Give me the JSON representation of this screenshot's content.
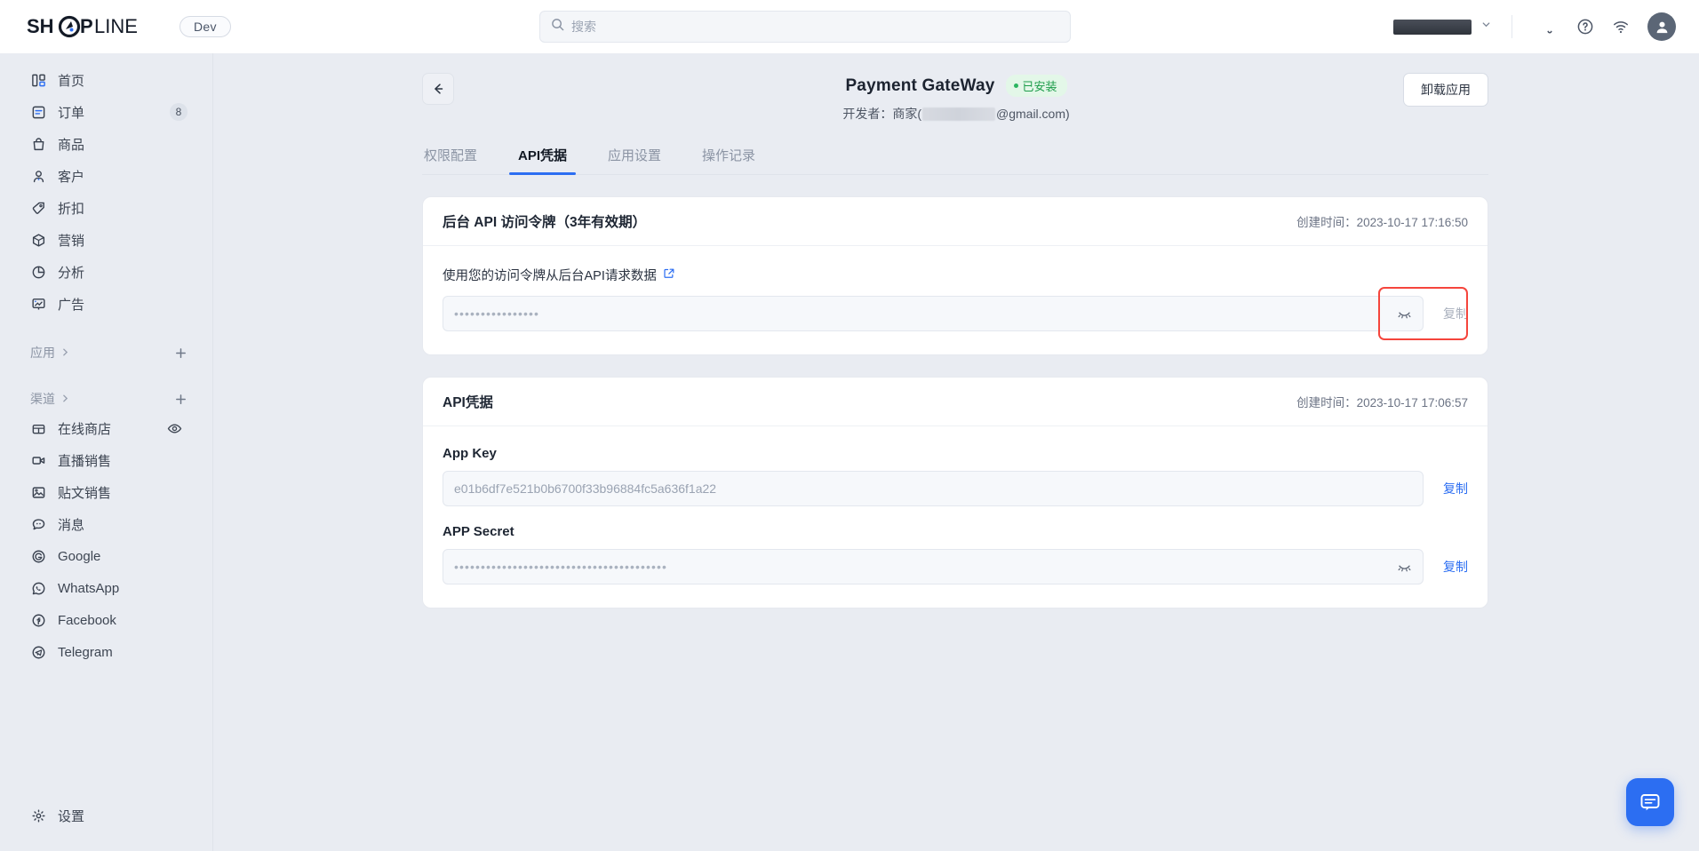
{
  "topbar": {
    "logo_text": "SHOPLINE",
    "dev_badge": "Dev",
    "search_placeholder": "搜索",
    "icons": {
      "search": "search-icon",
      "notification": "bell-icon",
      "help": "question-circle-icon",
      "wifi": "wifi-icon",
      "avatar": "user-avatar-icon",
      "chevron": "chevron-down-icon"
    }
  },
  "sidebar": {
    "items": [
      {
        "label": "首页",
        "icon": "dashboard-icon",
        "badge": ""
      },
      {
        "label": "订单",
        "icon": "order-icon",
        "badge": "8"
      },
      {
        "label": "商品",
        "icon": "bag-icon",
        "badge": ""
      },
      {
        "label": "客户",
        "icon": "user-icon",
        "badge": ""
      },
      {
        "label": "折扣",
        "icon": "tag-icon",
        "badge": ""
      },
      {
        "label": "营销",
        "icon": "cube-icon",
        "badge": ""
      },
      {
        "label": "分析",
        "icon": "pie-chart-icon",
        "badge": ""
      },
      {
        "label": "广告",
        "icon": "ads-icon",
        "badge": ""
      }
    ],
    "sections": [
      {
        "label": "应用",
        "icon": "chevron-right-icon",
        "action": "add-icon"
      },
      {
        "label": "渠道",
        "icon": "chevron-right-icon",
        "action": "add-icon"
      }
    ],
    "channels": [
      {
        "label": "在线商店",
        "icon": "store-icon",
        "trailing": "eye-icon"
      },
      {
        "label": "直播销售",
        "icon": "video-icon",
        "trailing": ""
      },
      {
        "label": "贴文销售",
        "icon": "image-icon",
        "trailing": ""
      },
      {
        "label": "消息",
        "icon": "message-icon",
        "trailing": ""
      },
      {
        "label": "Google",
        "icon": "google-icon",
        "trailing": ""
      },
      {
        "label": "WhatsApp",
        "icon": "whatsapp-icon",
        "trailing": ""
      },
      {
        "label": "Facebook",
        "icon": "facebook-icon",
        "trailing": ""
      },
      {
        "label": "Telegram",
        "icon": "telegram-icon",
        "trailing": ""
      }
    ],
    "settings": {
      "label": "设置",
      "icon": "gear-icon"
    }
  },
  "page": {
    "back_icon": "arrow-left-icon",
    "app_title": "Payment GateWay",
    "status_badge": "已安装",
    "developer_prefix": "开发者：商家(",
    "developer_suffix": "@gmail.com)",
    "uninstall_label": "卸载应用"
  },
  "tabs": [
    {
      "label": "权限配置",
      "active": false
    },
    {
      "label": "API凭据",
      "active": true
    },
    {
      "label": "应用设置",
      "active": false
    },
    {
      "label": "操作记录",
      "active": false
    }
  ],
  "token_card": {
    "title": "后台 API 访问令牌（3年有效期）",
    "created_label": "创建时间：",
    "created_time": "2023-10-17 17:16:50",
    "desc": "使用您的访问令牌从后台API请求数据",
    "external_icon": "external-link-icon",
    "token_masked": "••••••••••••••••",
    "eye_icon": "eye-closed-icon",
    "copy_label": "复制"
  },
  "credential_card": {
    "title": "API凭据",
    "created_label": "创建时间：",
    "created_time": "2023-10-17 17:06:57",
    "app_key_label": "App Key",
    "app_key_value": "e01b6df7e521b0b6700f33b96884fc5a636f1a22",
    "app_key_copy": "复制",
    "app_secret_label": "APP Secret",
    "app_secret_masked": "••••••••••••••••••••••••••••••••••••••••",
    "app_secret_eye": "eye-closed-icon",
    "app_secret_copy": "复制"
  },
  "chat": {
    "icon": "chat-bubble-icon"
  },
  "colors": {
    "accent": "#2c6ef2",
    "success": "#2bb560",
    "highlight": "#f5453c",
    "bg": "#e9ecf2"
  }
}
